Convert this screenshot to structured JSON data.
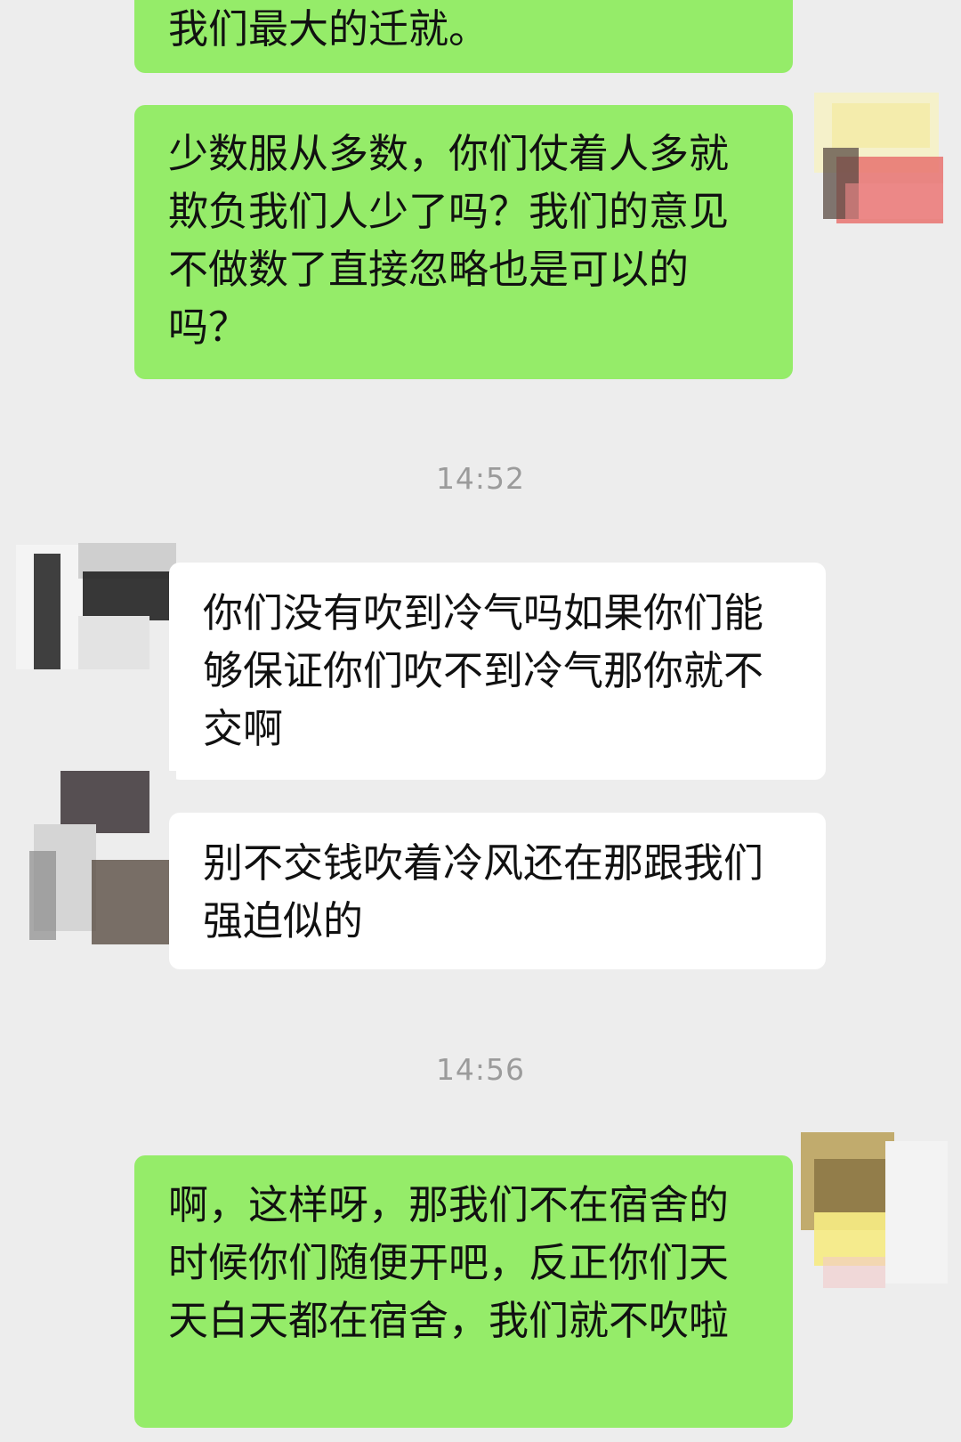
{
  "chat": {
    "messages": [
      {
        "side": "sent",
        "text": "我们最大的迁就。"
      },
      {
        "side": "sent",
        "text": "少数服从多数，你们仗着人多就欺负我们人少了吗？我们的意见不做数了直接忽略也是可以的吗？"
      },
      {
        "side": "received",
        "text": "你们没有吹到冷气吗如果你们能够保证你们吹不到冷气那你就不交啊"
      },
      {
        "side": "received",
        "text": "别不交钱吹着冷风还在那跟我们强迫似的"
      },
      {
        "side": "sent",
        "text": "啊，这样呀，那我们不在宿舍的时候你们随便开吧，反正你们天天白天都在宿舍，我们就不吹啦"
      }
    ],
    "timestamps": [
      "14:52",
      "14:56"
    ]
  },
  "colors": {
    "background": "#ededed",
    "sent_bubble": "#95ec69",
    "received_bubble": "#ffffff",
    "timestamp_text": "#9b9b9b"
  },
  "icons": {
    "avatar": "scribbled-out-avatar-icon"
  }
}
